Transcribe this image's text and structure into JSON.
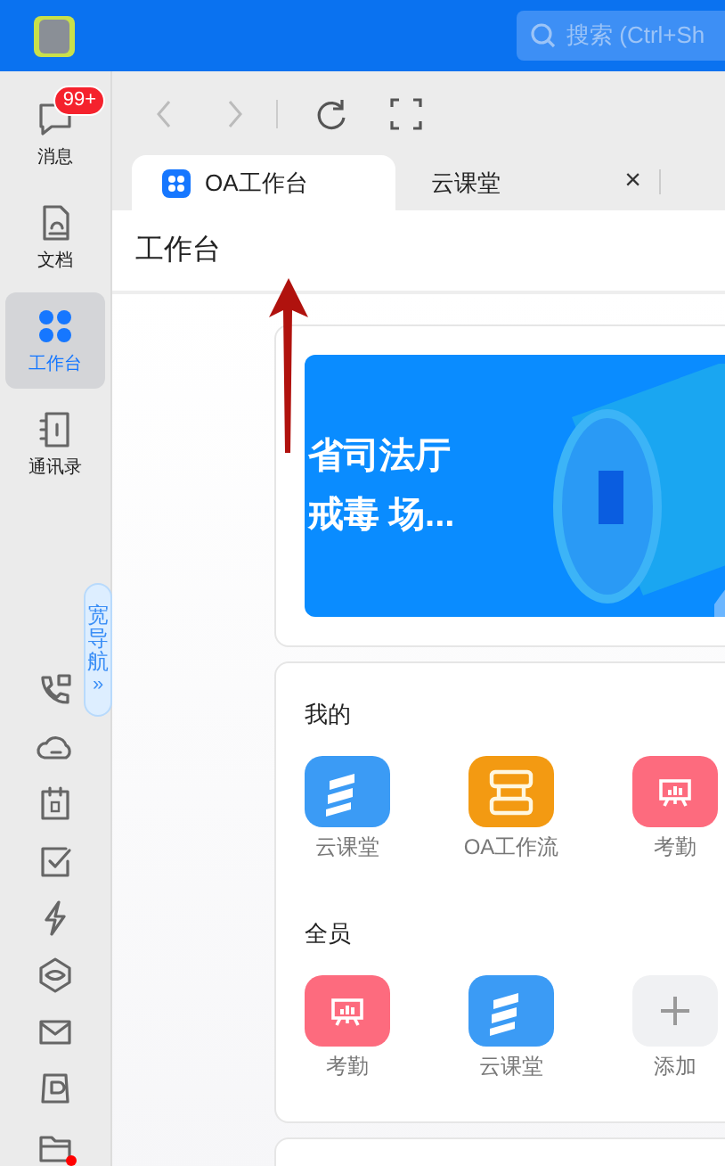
{
  "top_bar": {
    "search": {
      "placeholder": "搜索 (Ctrl+Sh"
    }
  },
  "sidebar": {
    "items": [
      {
        "label": "消息",
        "kind": "message",
        "badge": "99+",
        "selected": false
      },
      {
        "label": "文档",
        "kind": "doc",
        "selected": false
      },
      {
        "label": "工作台",
        "kind": "apps",
        "selected": true
      },
      {
        "label": "通讯录",
        "kind": "contacts",
        "selected": false
      }
    ],
    "wide_nav_toggle": {
      "label": "宽导航",
      "arrow": "»"
    },
    "tools": [
      {
        "kind": "phone"
      },
      {
        "kind": "cloud"
      },
      {
        "kind": "calendar"
      },
      {
        "kind": "check"
      },
      {
        "kind": "bolt"
      },
      {
        "kind": "hexagon"
      },
      {
        "kind": "mail"
      },
      {
        "kind": "drive"
      },
      {
        "kind": "folder"
      }
    ],
    "notification_dot": true
  },
  "toolbar": {
    "buttons": [
      {
        "kind": "back",
        "disabled": true
      },
      {
        "kind": "forward",
        "disabled": true
      },
      {
        "kind": "refresh",
        "disabled": false
      },
      {
        "kind": "fullscreen",
        "disabled": false
      }
    ]
  },
  "tabs": [
    {
      "label": "OA工作台",
      "selected": true,
      "kind": "app"
    },
    {
      "label": "云课堂",
      "selected": false,
      "kind": "page",
      "close": "×"
    }
  ],
  "page_title": "工作台",
  "banner": {
    "lines": [
      "省司法厅",
      "戒毒 场..."
    ]
  },
  "sections": [
    {
      "title": "我的",
      "apps": [
        {
          "label": "云课堂",
          "kind": "stripes"
        },
        {
          "label": "OA工作流",
          "kind": "flow"
        },
        {
          "label": "考勤",
          "kind": "attendance"
        }
      ]
    },
    {
      "title": "全员",
      "apps": [
        {
          "label": "考勤",
          "kind": "attendance"
        },
        {
          "label": "云课堂",
          "kind": "stripes"
        },
        {
          "label": "添加",
          "kind": "add"
        }
      ]
    }
  ]
}
